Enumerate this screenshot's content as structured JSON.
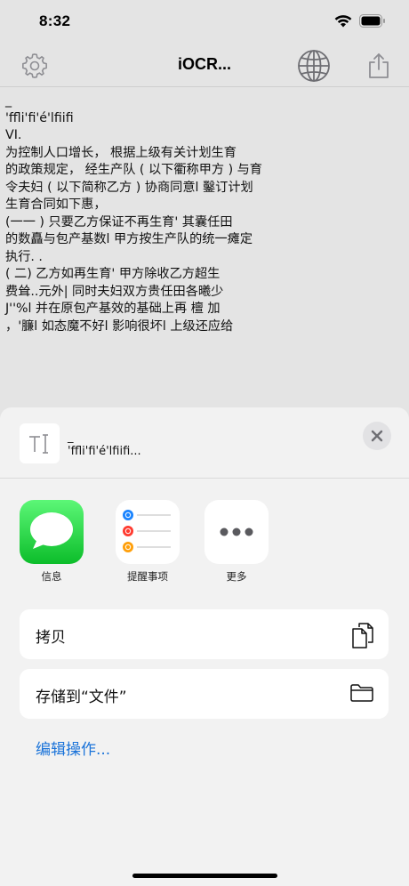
{
  "status": {
    "time": "8:32"
  },
  "nav": {
    "title": "iOCR..."
  },
  "document": {
    "lines": [
      "_",
      "'ffli'fi'é'lfiifi",
      "",
      "VI.",
      "",
      "为控制人口增长， 根据上级有关计划生育",
      "的政策规定， 经生产队 ( 以下衢称甲方 ) 与育",
      "令夫妇 ( 以下简称乙方 ) 协商同意l 鑿订计划",
      "生育合同如下惠，",
      "",
      "(一一 ) 只要乙方保证不再生育' 其囊任田",
      "的数矗与包产基数l 甲方按生产队的统一瘫定",
      "执行. .",
      "",
      "( 二) 乙方如再生育' 甲方除收乙方超生",
      "费耸..元外| 同时夫妇双方贵任田各曦少",
      "J''%l 并在原包产基效的基础上再 檀 加",
      "",
      "，'臁l 如态魔不好l 影响很坏l 上级还应给"
    ]
  },
  "share": {
    "preview_text": "_\n'ffli'fi'é'lfiifi...",
    "apps": [
      {
        "label": "信息"
      },
      {
        "label": "提醒事项"
      },
      {
        "label": "更多"
      }
    ],
    "actions": [
      {
        "label": "拷贝"
      },
      {
        "label": "存储到“文件”"
      }
    ],
    "edit_actions": "编辑操作...",
    "colors": {
      "messages_green": "#34c759",
      "link_blue": "#1a73d9"
    }
  }
}
